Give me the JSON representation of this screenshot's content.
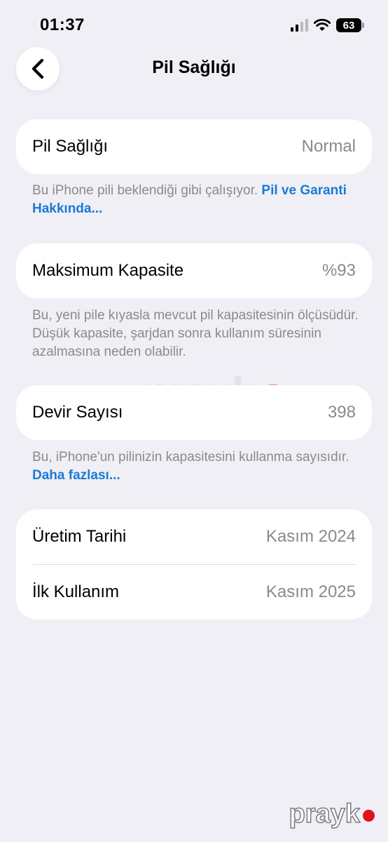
{
  "status_bar": {
    "time": "01:37",
    "battery_level": "63"
  },
  "nav": {
    "title": "Pil Sağlığı",
    "back_icon": "chevron-left-icon"
  },
  "battery_health": {
    "label": "Pil Sağlığı",
    "value": "Normal",
    "note_text": "Bu iPhone pili beklendiği gibi çalışıyor. ",
    "note_link": "Pil ve Garanti Hakkında..."
  },
  "max_capacity": {
    "label": "Maksimum Kapasite",
    "value": "%93",
    "note_text": "Bu, yeni pile kıyasla mevcut pil kapasitesinin ölçüsüdür. Düşük kapasite, şarjdan sonra kullanım süresinin azalmasına neden olabilir."
  },
  "cycle_count": {
    "label": "Devir Sayısı",
    "value": "398",
    "note_text": "Bu, iPhone'un pilinizin kapasitesini kullanma sayısıdır. ",
    "note_link": "Daha fazlası..."
  },
  "dates": {
    "manufacture_label": "Üretim Tarihi",
    "manufacture_value": "Kasım 2024",
    "first_use_label": "İlk Kullanım",
    "first_use_value": "Kasım 2025"
  },
  "watermark": {
    "center": "prayk",
    "corner": "prayk"
  }
}
